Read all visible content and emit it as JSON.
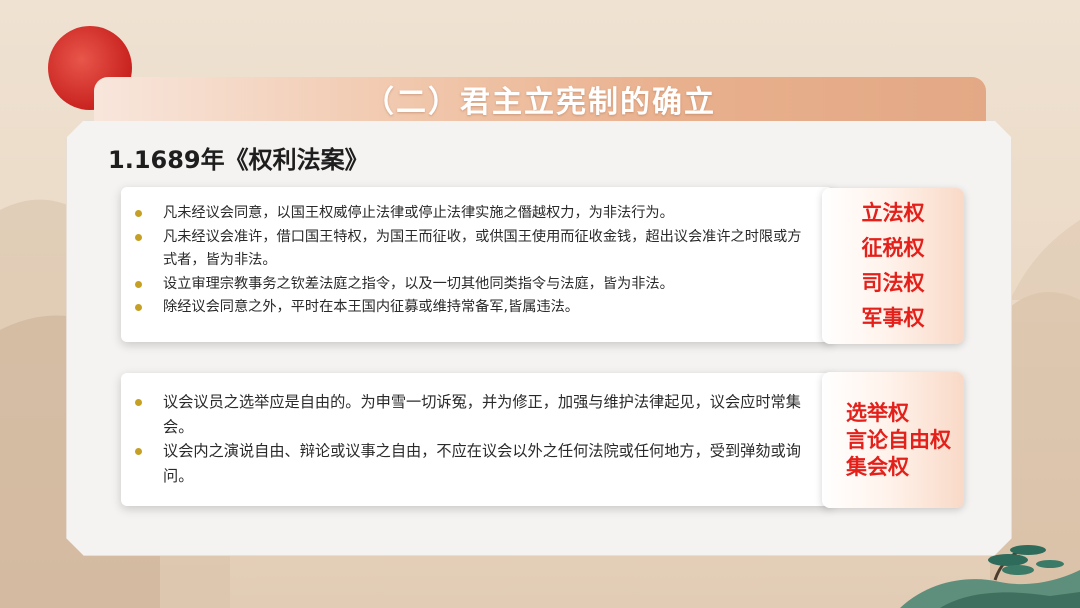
{
  "title": "（二）君主立宪制的确立",
  "section_heading": "1.1689年《权利法案》",
  "card1": {
    "bullets": [
      "凡未经议会同意，以国王权威停止法律或停止法律实施之僭越权力，为非法行为。",
      "凡未经议会准许，借口国王特权，为国王而征收，或供国王使用而征收金钱，超出议会准许之时限或方式者，皆为非法。",
      "设立审理宗教事务之钦差法庭之指令，以及一切其他同类指令与法庭，皆为非法。",
      "除经议会同意之外，平时在本王国内征募或维持常备军,皆属违法。"
    ],
    "rights": [
      "立法权",
      "征税权",
      "司法权",
      "军事权"
    ]
  },
  "card2": {
    "bullets": [
      "议会议员之选举应是自由的。为申雪一切诉冤，并为修正，加强与维护法律起见，议会应时常集会。",
      "议会内之演说自由、辩论或议事之自由，不应在议会以外之任何法院或任何地方，受到弹劾或询问。"
    ],
    "rights": [
      "选举权",
      "言论自由权",
      "集会权"
    ]
  },
  "colors": {
    "accent_red": "#e4201b",
    "bullet_gold": "#c6a024",
    "sun_red": "#c9231f"
  }
}
